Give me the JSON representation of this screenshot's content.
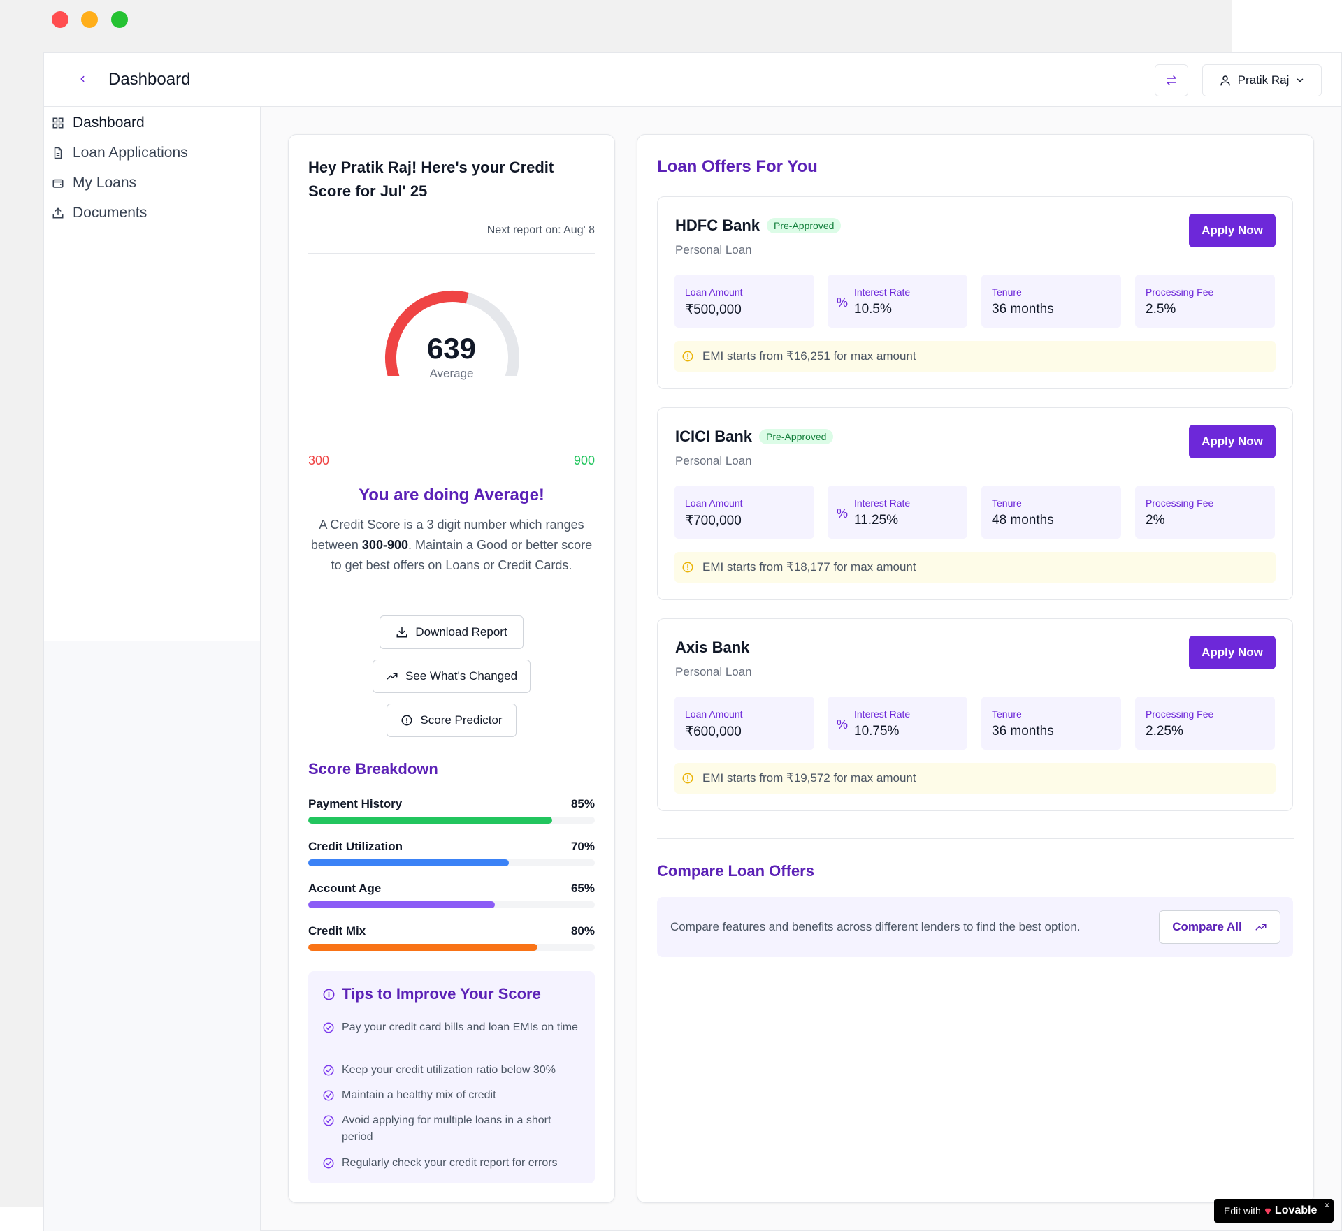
{
  "header": {
    "title": "Dashboard",
    "user_name": "Pratik Raj"
  },
  "sidebar": {
    "items": [
      {
        "label": "Dashboard",
        "icon": "grid-icon"
      },
      {
        "label": "Loan Applications",
        "icon": "file-icon"
      },
      {
        "label": "My Loans",
        "icon": "wallet-icon"
      },
      {
        "label": "Documents",
        "icon": "upload-icon"
      }
    ]
  },
  "credit": {
    "greeting": "Hey Pratik Raj! Here's your Credit Score for Jul' 25",
    "next_report": "Next report on: Aug' 8",
    "score": "639",
    "score_value": 639,
    "score_label": "Average",
    "min": "300",
    "max": "900",
    "status_heading": "You are doing Average!",
    "desc_1": "A Credit Score is a 3 digit number which ranges between ",
    "desc_bold": "300-900",
    "desc_2": ". Maintain a Good or better score to get best offers on Loans or Credit Cards.",
    "btn_download": "Download Report",
    "btn_changed": "See What's Changed",
    "btn_predictor": "Score Predictor",
    "colors": {
      "gauge_fill": "#ef4444",
      "gauge_track": "#e5e7eb"
    }
  },
  "breakdown": {
    "title": "Score Breakdown",
    "items": [
      {
        "label": "Payment History",
        "pct_text": "85%",
        "value": 85,
        "color": "#22c55e"
      },
      {
        "label": "Credit Utilization",
        "pct_text": "70%",
        "value": 70,
        "color": "#3b82f6"
      },
      {
        "label": "Account Age",
        "pct_text": "65%",
        "value": 65,
        "color": "#8b5cf6"
      },
      {
        "label": "Credit Mix",
        "pct_text": "80%",
        "value": 80,
        "color": "#f97316"
      }
    ]
  },
  "tips": {
    "title": "Tips to Improve Your Score",
    "items": [
      "Pay your credit card bills and loan EMIs on time",
      "Keep your credit utilization ratio below 30%",
      "Maintain a healthy mix of credit",
      "Avoid applying for multiple loans in a short period",
      "Regularly check your credit report for errors"
    ]
  },
  "offers": {
    "title": "Loan Offers For You",
    "labels": {
      "amount": "Loan Amount",
      "rate": "Interest Rate",
      "tenure": "Tenure",
      "fee": "Processing Fee",
      "apply": "Apply Now",
      "badge": "Pre-Approved"
    },
    "items": [
      {
        "bank": "HDFC Bank",
        "pre_approved": true,
        "type": "Personal Loan",
        "amount": "₹500,000",
        "rate": "10.5%",
        "tenure": "36 months",
        "fee": "2.5%",
        "emi": "EMI starts from ₹16,251 for max amount"
      },
      {
        "bank": "ICICI Bank",
        "pre_approved": true,
        "type": "Personal Loan",
        "amount": "₹700,000",
        "rate": "11.25%",
        "tenure": "48 months",
        "fee": "2%",
        "emi": "EMI starts from ₹18,177 for max amount"
      },
      {
        "bank": "Axis Bank",
        "pre_approved": false,
        "type": "Personal Loan",
        "amount": "₹600,000",
        "rate": "10.75%",
        "tenure": "36 months",
        "fee": "2.25%",
        "emi": "EMI starts from ₹19,572 for max amount"
      }
    ]
  },
  "compare": {
    "title": "Compare Loan Offers",
    "text": "Compare features and benefits across different lenders to find the best option.",
    "button": "Compare All"
  },
  "lovable": {
    "prefix": "Edit with",
    "brand": "Lovable",
    "close": "×"
  }
}
